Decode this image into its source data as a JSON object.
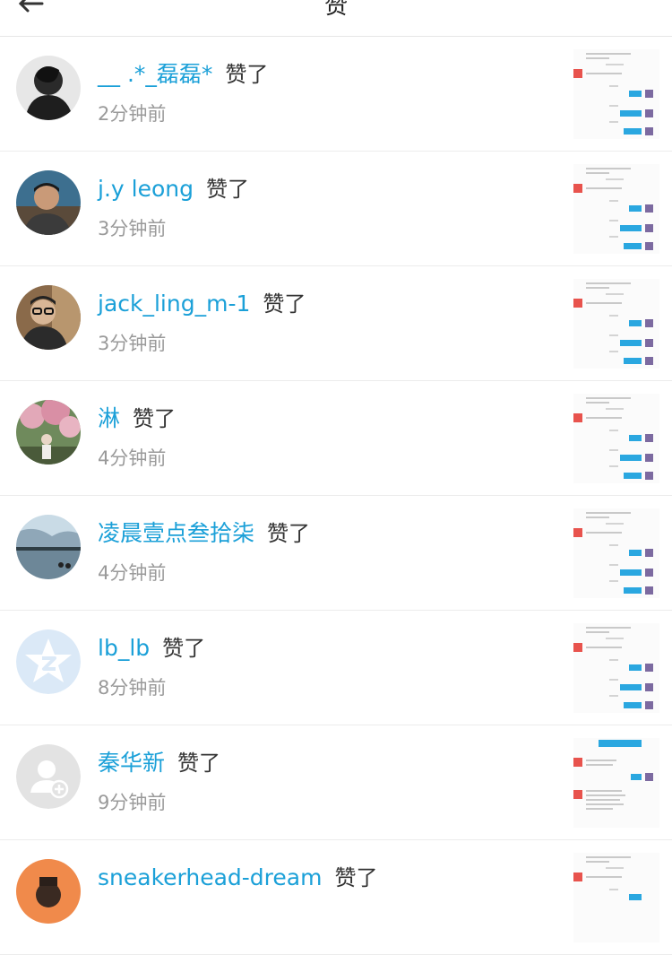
{
  "header": {
    "title": "赞",
    "back_icon": "arrow-left-icon"
  },
  "colors": {
    "username": "#1ba0d8",
    "time": "#9a9a9a",
    "divider": "#ececec"
  },
  "items": [
    {
      "username": "__ .*_磊磊*",
      "action": "赞了",
      "time": "2分钟前",
      "avatar": "photo-dark-hair"
    },
    {
      "username": "j.y leong",
      "action": "赞了",
      "time": "3分钟前",
      "avatar": "photo-man-outdoor"
    },
    {
      "username": "jack_ling_m-1",
      "action": "赞了",
      "time": "3分钟前",
      "avatar": "photo-man-glasses"
    },
    {
      "username": "淋",
      "action": "赞了",
      "time": "4分钟前",
      "avatar": "photo-blossom-tree"
    },
    {
      "username": "凌晨壹点叁拾柒",
      "action": "赞了",
      "time": "4分钟前",
      "avatar": "photo-lake"
    },
    {
      "username": "lb_lb",
      "action": "赞了",
      "time": "8分钟前",
      "avatar": "qzone-star-icon"
    },
    {
      "username": "秦华新",
      "action": "赞了",
      "time": "9分钟前",
      "avatar": "default-user-icon"
    },
    {
      "username": "sneakerhead-dream",
      "action": "赞了",
      "time": "",
      "avatar": "photo-orange"
    }
  ]
}
